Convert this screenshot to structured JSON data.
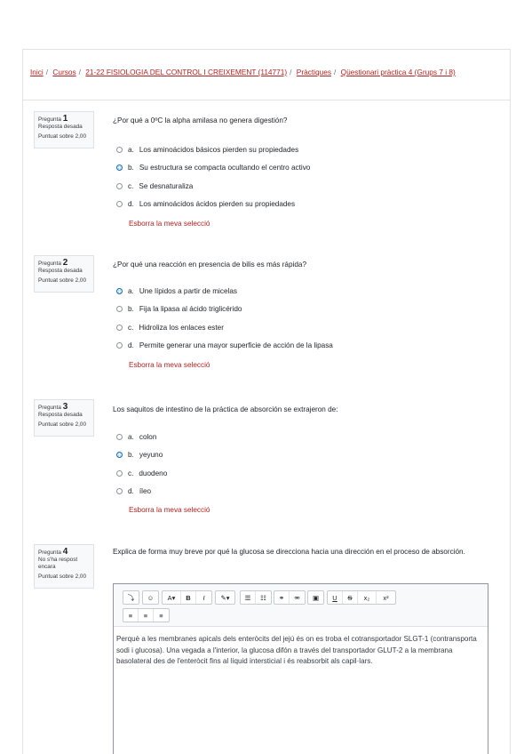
{
  "breadcrumb": [
    "Inici",
    "Cursos",
    "21-22 FISIOLOGIA DEL CONTROL I CREIXEMENT (114771)",
    "Pràctiques",
    "Qüestionari pràctica 4 (Grups 7 i 8)"
  ],
  "clear_label": "Esborra la meva selecció",
  "questions": [
    {
      "label": "Pregunta",
      "number": "1",
      "status": "Resposta desada",
      "grade": "Puntuat sobre 2,00",
      "text": "¿Por qué a 0ºC la alpha amilasa no genera digestión?",
      "options": [
        {
          "letter": "a.",
          "text": "Los aminoácidos básicos pierden su propiedades",
          "selected": false
        },
        {
          "letter": "b.",
          "text": "Su estructura se compacta ocultando el centro activo",
          "selected": true
        },
        {
          "letter": "c.",
          "text": "Se desnaturaliza",
          "selected": false
        },
        {
          "letter": "d.",
          "text": "Los aminoácidos ácidos pierden su propiedades",
          "selected": false
        }
      ]
    },
    {
      "label": "Pregunta",
      "number": "2",
      "status": "Resposta desada",
      "grade": "Puntuat sobre 2,00",
      "text": "¿Por qué una reacción en presencia de bilis es más rápida?",
      "options": [
        {
          "letter": "a.",
          "text": "Une lípidos a partir de micelas",
          "selected": true
        },
        {
          "letter": "b.",
          "text": "Fija la lipasa al ácido triglicérido",
          "selected": false
        },
        {
          "letter": "c.",
          "text": "Hidroliza los enlaces ester",
          "selected": false
        },
        {
          "letter": "d.",
          "text": "Permite generar una mayor superficie de acción de la lipasa",
          "selected": false
        }
      ]
    },
    {
      "label": "Pregunta",
      "number": "3",
      "status": "Resposta desada",
      "grade": "Puntuat sobre 2,00",
      "text": "Los saquitos de intestino de la práctica de absorción se extrajeron de:",
      "options": [
        {
          "letter": "a.",
          "text": "colon",
          "selected": false
        },
        {
          "letter": "b.",
          "text": "yeyuno",
          "selected": true
        },
        {
          "letter": "c.",
          "text": "duodeno",
          "selected": false
        },
        {
          "letter": "d.",
          "text": "íleo",
          "selected": false
        }
      ]
    },
    {
      "label": "Pregunta",
      "number": "4",
      "status": "No s'ha respost encara",
      "grade": "Puntuat sobre 2,00",
      "text": "Explica de forma muy breve por qué la glucosa se direcciona hacia una dirección en el proceso de absorción.",
      "answer": "Perquè a les membranes apicals dels enteròcits del jejú és on es troba el cotransportador SLGT-1 (contransporta sodi i glucosa). Una vegada a l'interior, la glucosa difón a través del transportador GLUT-2 a la membrana basolateral des de l'enteròcit fins al líquid intersticial i és reabsorbit als capil·lars."
    }
  ],
  "toolbar": {
    "row1": [
      {
        "icon": "collapse-icon",
        "glyph": "⤵"
      },
      {
        "icon": "emoticon-icon",
        "glyph": "☺"
      },
      {
        "icon": "font-color-icon",
        "glyph": "A▾"
      },
      {
        "icon": "bold-icon",
        "glyph": "B"
      },
      {
        "icon": "italic-icon",
        "glyph": "I"
      },
      {
        "icon": "brush-icon",
        "glyph": "✎▾"
      },
      {
        "icon": "bullet-list-icon",
        "glyph": "☰"
      },
      {
        "icon": "numbered-list-icon",
        "glyph": "☷"
      },
      {
        "icon": "link-icon",
        "glyph": "⚭"
      },
      {
        "icon": "unlink-icon",
        "glyph": "⚮"
      },
      {
        "icon": "image-icon",
        "glyph": "▣"
      },
      {
        "icon": "underline-icon",
        "glyph": "U"
      },
      {
        "icon": "strikethrough-icon",
        "glyph": "S"
      },
      {
        "icon": "subscript-icon",
        "glyph": "x₂"
      },
      {
        "icon": "superscript-icon",
        "glyph": "x²"
      }
    ],
    "row2": [
      {
        "icon": "align-left-icon",
        "glyph": "≡"
      },
      {
        "icon": "align-center-icon",
        "glyph": "≡"
      },
      {
        "icon": "align-right-icon",
        "glyph": "≡"
      }
    ]
  },
  "colors": {
    "link": "#b3231f",
    "accent": "#0f6cbf"
  }
}
